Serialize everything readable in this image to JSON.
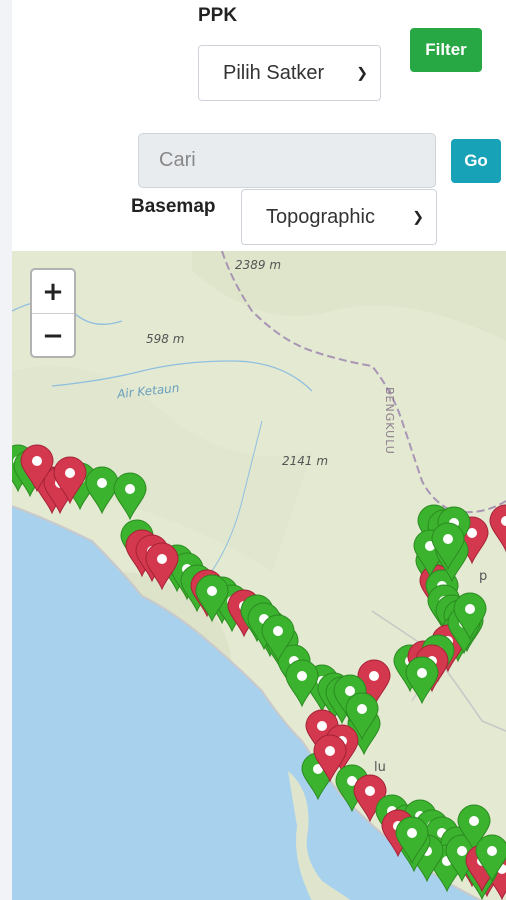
{
  "filters": {
    "ppk_label": "PPK",
    "satker_select": "Pilih Satker",
    "filter_button": "Filter",
    "search_placeholder": "Cari",
    "go_button": "Go",
    "basemap_label": "Basemap",
    "basemap_select": "Topographic"
  },
  "map": {
    "zoom_in": "+",
    "zoom_out": "−",
    "labels": {
      "elev1": "2389 m",
      "elev2": "598 m",
      "elev3": "2141 m",
      "river": "Air Ketaun",
      "province": "BENGKULU",
      "city_fragment": "lu",
      "p_fragment": "p"
    },
    "marker_colors": {
      "green": "#3cb32f",
      "red": "#d4384f"
    },
    "marker_count": {
      "green": 66,
      "red": 20
    }
  }
}
